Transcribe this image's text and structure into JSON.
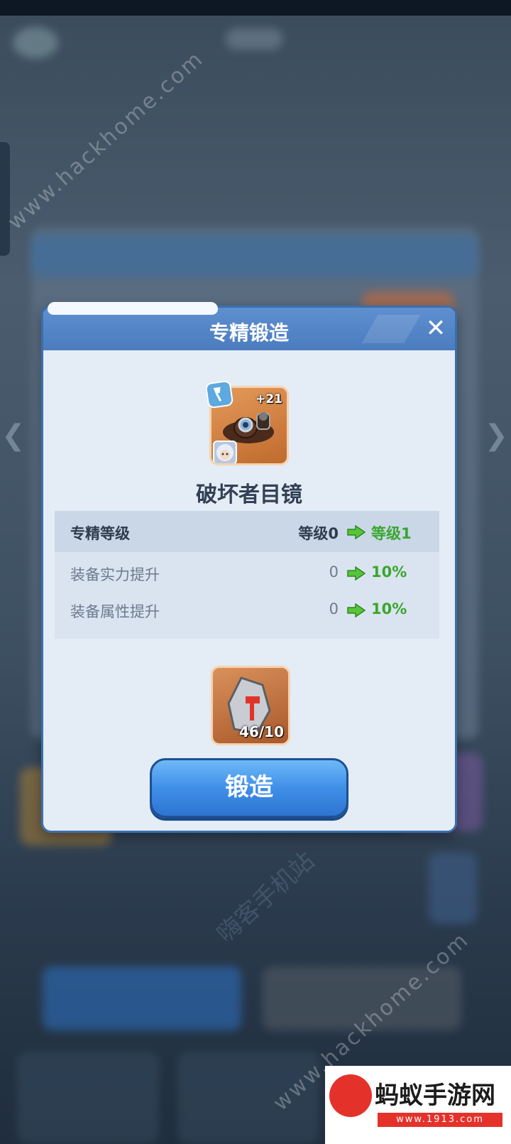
{
  "dialog": {
    "title": "专精锻造",
    "close_label": "✕"
  },
  "item": {
    "name": "破坏者目镜",
    "level_badge": "+21"
  },
  "stats": {
    "header": {
      "label": "专精等级",
      "from": "等级0",
      "to": "等级1"
    },
    "rows": [
      {
        "label": "装备实力提升",
        "from": "0",
        "to": "10%"
      },
      {
        "label": "装备属性提升",
        "from": "0",
        "to": "10%"
      }
    ]
  },
  "material": {
    "count": "46/10"
  },
  "forge_button": {
    "label": "锻造"
  },
  "watermarks": {
    "site": "www.hackhome.com",
    "center": "嗨客手机站"
  },
  "brand": {
    "name": "蚂蚁手游网",
    "url": "www.1913.com"
  },
  "colors": {
    "dialog_header": "#4a7cbf",
    "forge_button": "#3f8fe8",
    "increase_green": "#3aa62e",
    "item_frame": "#c06a2e"
  }
}
